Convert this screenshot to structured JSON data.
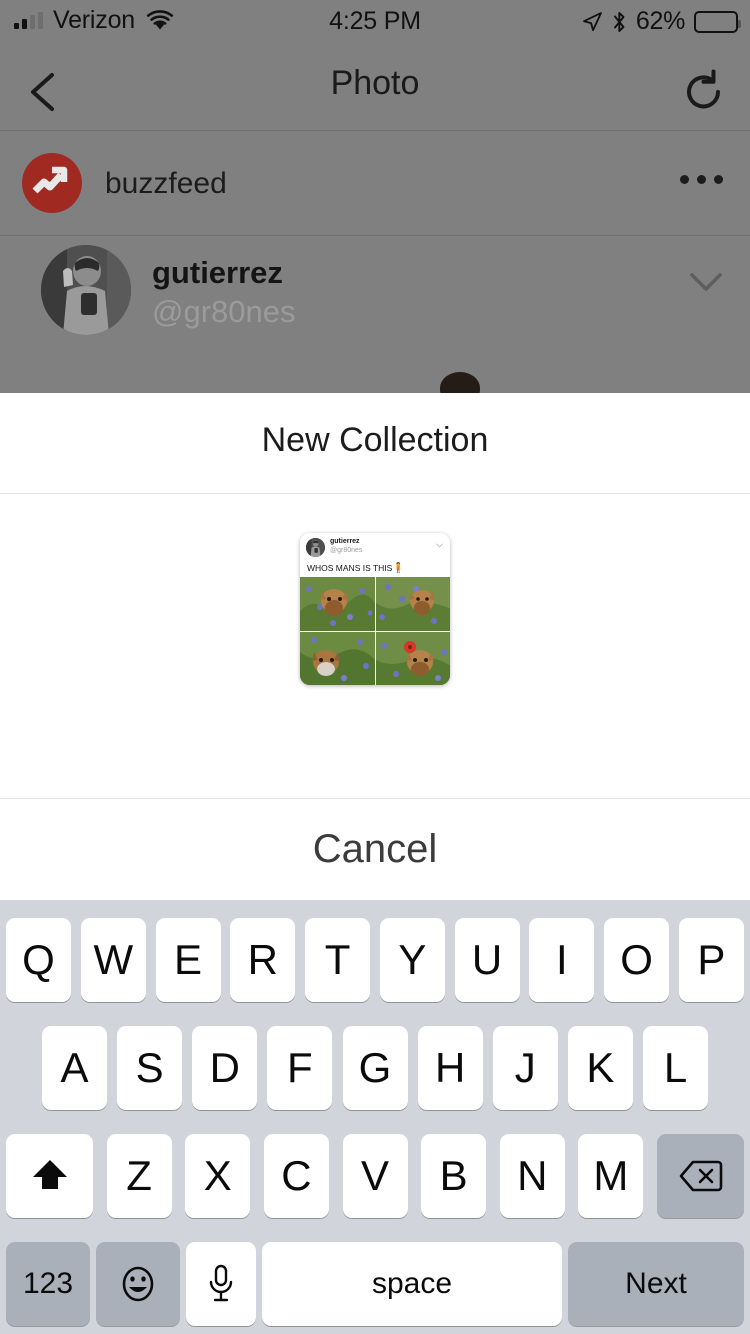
{
  "status_bar": {
    "carrier": "Verizon",
    "time": "4:25 PM",
    "battery_percent": "62%",
    "battery_level": 62,
    "icons": [
      "signal-bars-icon",
      "wifi-icon",
      "location-arrow-icon",
      "bluetooth-icon",
      "battery-icon"
    ]
  },
  "nav_bar": {
    "title": "Photo",
    "back_icon": "chevron-left-icon",
    "refresh_icon": "refresh-icon"
  },
  "background_app": {
    "source_row": {
      "name": "buzzfeed",
      "logo_icon": "buzzfeed-trending-arrow-icon",
      "logo_color": "#a02a21",
      "more_icon": "more-horizontal-icon"
    },
    "tweet_row": {
      "display_name": "gutierrez",
      "handle": "@gr80nes",
      "chevron_icon": "chevron-down-icon",
      "avatar": "user-avatar"
    }
  },
  "sheet": {
    "title": "New Collection",
    "name_input_value": "",
    "name_input_placeholder": "",
    "cancel_label": "Cancel",
    "thumbnail": {
      "display_name": "gutierrez",
      "handle": "@gr80nes",
      "chevron_icon": "chevron-down-icon",
      "tweet_text": "WHOS MANS IS THIS",
      "tweet_emoji": "🧍",
      "photo_count": 4,
      "photo_alt": "dog-in-wildflowers"
    }
  },
  "keyboard": {
    "layout": "qwerty-uppercase",
    "row1": [
      "Q",
      "W",
      "E",
      "R",
      "T",
      "Y",
      "U",
      "I",
      "O",
      "P"
    ],
    "row2": [
      "A",
      "S",
      "D",
      "F",
      "G",
      "H",
      "J",
      "K",
      "L"
    ],
    "row3_letters": [
      "Z",
      "X",
      "C",
      "V",
      "B",
      "N",
      "M"
    ],
    "shift_icon": "shift-up-arrow-icon",
    "backspace_icon": "backspace-delete-icon",
    "numbers_label": "123",
    "emoji_icon": "emoji-smiley-icon",
    "dictation_icon": "microphone-icon",
    "space_label": "space",
    "return_label": "Next"
  },
  "colors": {
    "dim_overlay": "#808080",
    "sheet_background": "#ffffff",
    "keyboard_background": "#d1d5db",
    "key_white": "#ffffff",
    "key_gray": "#aab0ba",
    "brand_red": "#a02a21",
    "handle_gray": "#9b9b9b"
  }
}
